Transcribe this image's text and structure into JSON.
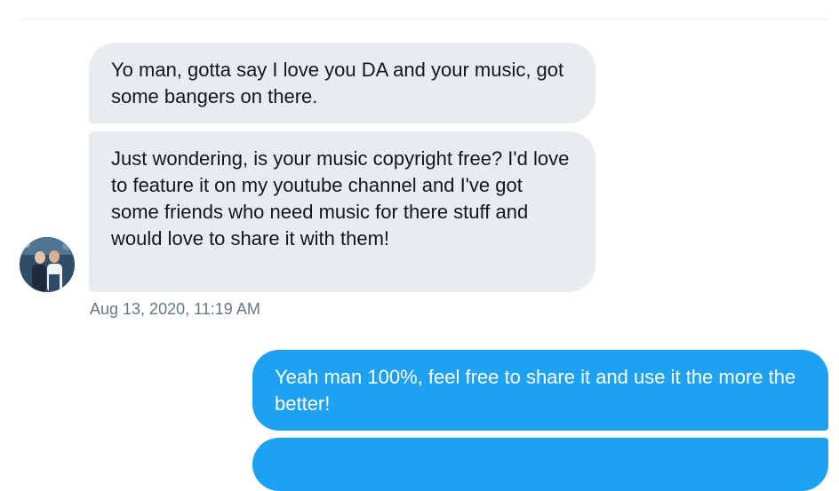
{
  "conversation": {
    "incoming": {
      "avatar_icon": "user-avatar-photo-icon",
      "messages": [
        {
          "text": "Yo man, gotta say I love you DA and your music, got some bangers on there."
        },
        {
          "text": "Just wondering, is your music copyright free? I'd love to feature it on my youtube channel and I've got some friends who need music for there stuff and would love to share it with them!"
        }
      ],
      "timestamp": "Aug 13, 2020, 11:19 AM"
    },
    "outgoing": {
      "messages": [
        {
          "text": "Yeah man 100%, feel free to share it and use it the more the better!"
        }
      ]
    }
  },
  "colors": {
    "incoming_bubble": "#e6ecf0",
    "outgoing_bubble": "#1da1f2",
    "timestamp_text": "#657786",
    "message_text": "#14171a"
  }
}
